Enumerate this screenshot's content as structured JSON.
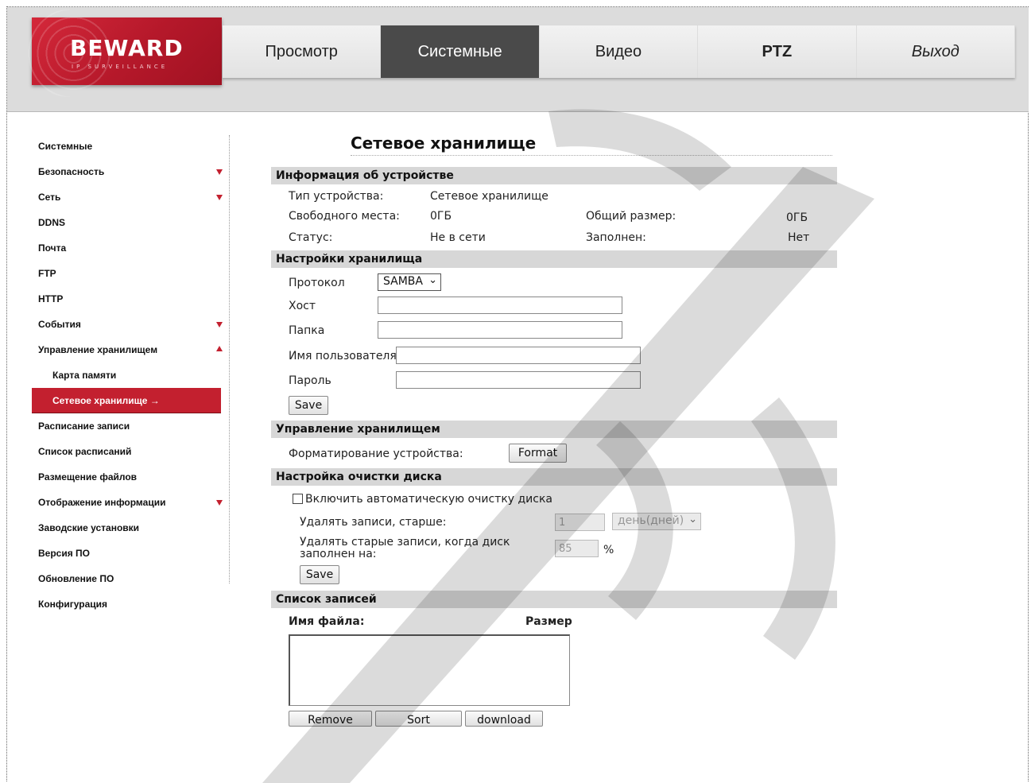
{
  "brand": {
    "logo_text": "BEWARD",
    "logo_sub": "IP SURVEILLANCE"
  },
  "nav": {
    "items": [
      {
        "label": "Просмотр"
      },
      {
        "label": "Системные"
      },
      {
        "label": "Видео"
      },
      {
        "label": "PTZ"
      },
      {
        "label": "Выход"
      }
    ]
  },
  "sidebar": {
    "items": [
      {
        "label": "Системные"
      },
      {
        "label": "Безопасность"
      },
      {
        "label": "Сеть"
      },
      {
        "label": "DDNS"
      },
      {
        "label": "Почта"
      },
      {
        "label": "FTP"
      },
      {
        "label": "HTTP"
      },
      {
        "label": "События"
      },
      {
        "label": "Управление хранилищем"
      },
      {
        "label": "Карта памяти"
      },
      {
        "label": "Сетевое хранилище →"
      },
      {
        "label": "Расписание записи"
      },
      {
        "label": "Список расписаний"
      },
      {
        "label": "Размещение файлов"
      },
      {
        "label": "Отображение информации"
      },
      {
        "label": "Заводские установки"
      },
      {
        "label": "Версия ПО"
      },
      {
        "label": "Обновление ПО"
      },
      {
        "label": "Конфигурация"
      }
    ]
  },
  "page": {
    "title": "Сетевое хранилище"
  },
  "device_info": {
    "header": "Информация об устройстве",
    "type_label": "Тип устройства:",
    "type_value": "Сетевое хранилище",
    "free_label": "Свободного места:",
    "free_value": "0ГБ",
    "total_label": "Общий размер:",
    "total_value": "0ГБ",
    "status_label": "Статус:",
    "status_value": "Не в сети",
    "full_label": "Заполнен:",
    "full_value": "Нет"
  },
  "storage_settings": {
    "header": "Настройки хранилища",
    "protocol_label": "Протокол",
    "protocol_value": "SAMBA",
    "host_label": "Хост",
    "host_value": "",
    "folder_label": "Папка",
    "folder_value": "",
    "user_label": "Имя пользователя",
    "user_value": "",
    "password_label": "Пароль",
    "password_value": "",
    "save_label": "Save"
  },
  "storage_management": {
    "header": "Управление хранилищем",
    "format_label": "Форматирование устройства:",
    "format_button": "Format"
  },
  "disk_cleanup": {
    "header": "Настройка очистки диска",
    "enable_label": "Включить автоматическую очистку диска",
    "enabled": false,
    "older_label": "Удалять записи, старше:",
    "older_value": "1",
    "older_unit": "день(дней)",
    "full_label_1": "Удалять старые записи, когда диск",
    "full_label_2": "заполнен на:",
    "full_value": "85",
    "percent": "%",
    "save_label": "Save"
  },
  "records": {
    "header": "Список записей",
    "col_filename": "Имя файла:",
    "col_size": "Размер",
    "remove_label": "Remove",
    "sort_label": "Sort",
    "download_label": "download"
  }
}
